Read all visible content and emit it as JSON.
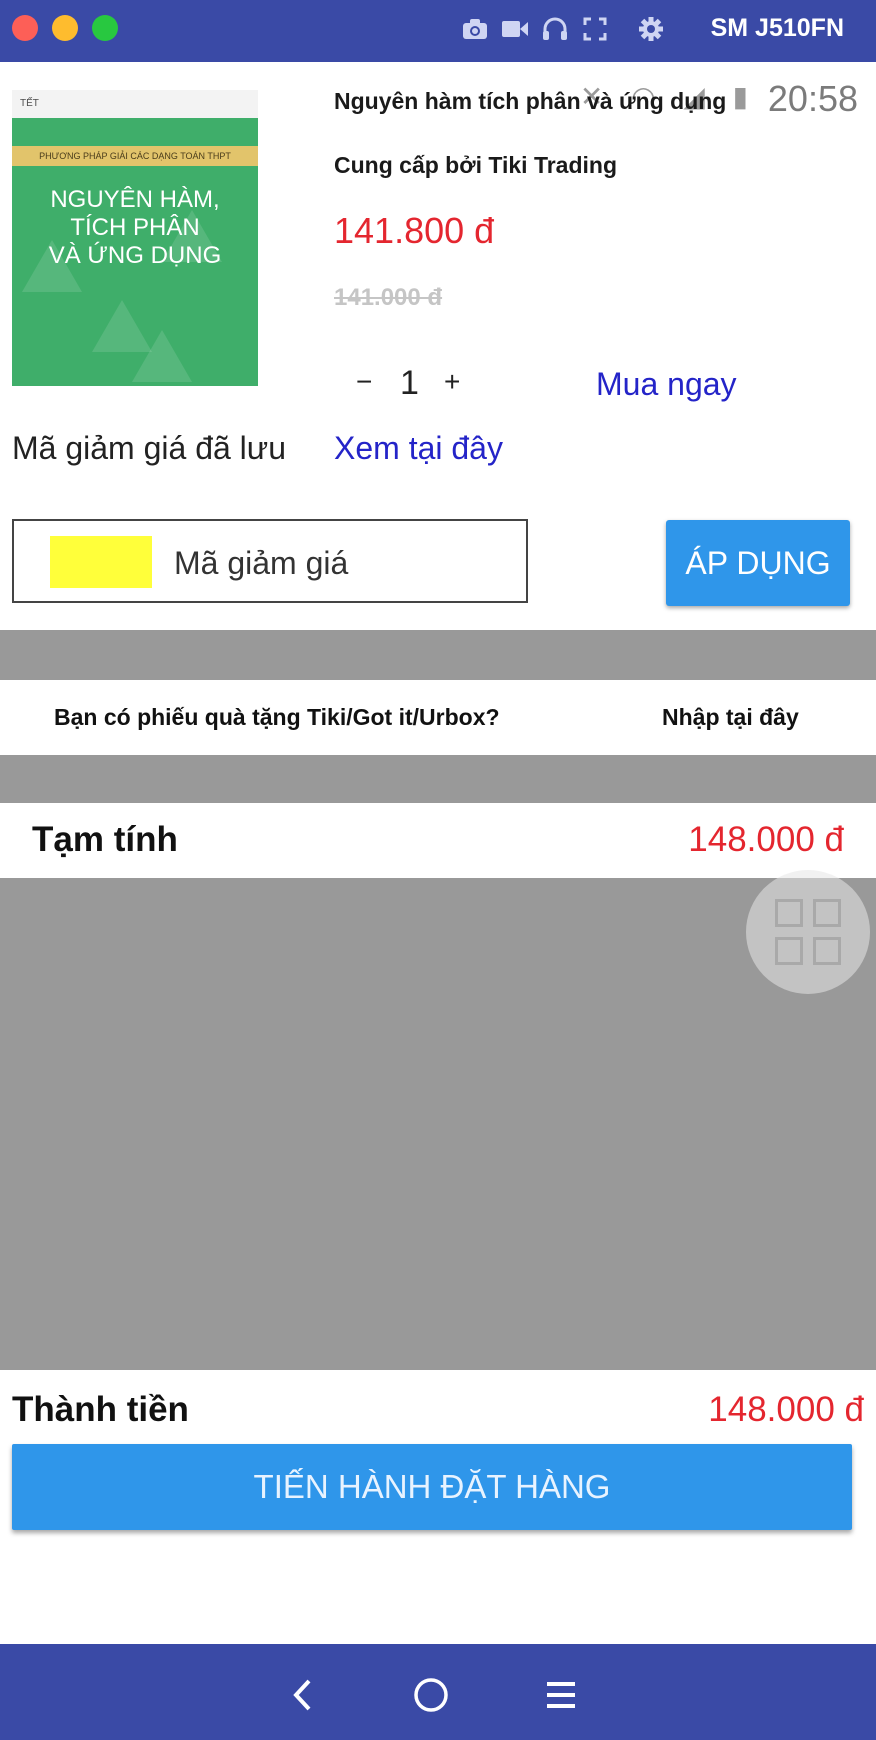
{
  "window": {
    "device_name": "SM J510FN"
  },
  "toolbar_icons": [
    "camera-icon",
    "video-icon",
    "headphones-icon",
    "fullscreen-icon",
    "settings-icon"
  ],
  "status_bar": {
    "time": "20:58"
  },
  "product": {
    "cover_header": "TẾT",
    "cover_band": "PHƯƠNG PHÁP GIẢI CÁC DẠNG TOÁN THPT",
    "cover_line1": "NGUYÊN HÀM,",
    "cover_line2": "TÍCH PHÂN",
    "cover_line3": "VÀ ỨNG DỤNG",
    "title": "Nguyên hàm tích phân và ứng dụng",
    "seller": "Cung cấp bởi Tiki Trading",
    "price": "141.800 đ",
    "old_price": "141.000 đ",
    "quantity": "1",
    "minus": "−",
    "plus": "+",
    "buy_now": "Mua ngay"
  },
  "coupon": {
    "saved_label": "Mã giảm giá đã lưu",
    "saved_link": "Xem tại đây",
    "input_placeholder": "Mã giảm giá",
    "apply_label": "ÁP DỤNG"
  },
  "gift": {
    "question": "Bạn có phiếu quà tặng Tiki/Got it/Urbox?",
    "link": "Nhập tại đây"
  },
  "summary": {
    "subtotal_label": "Tạm tính",
    "subtotal_value": "148.000 đ",
    "total_label": "Thành tiền",
    "total_value": "148.000 đ",
    "checkout_label": "TIẾN HÀNH ĐẶT HÀNG"
  },
  "colors": {
    "window_bar": "#3a4aa6",
    "accent_button": "#2f96ea",
    "price_red": "#e4262f",
    "link_blue": "#2424c8",
    "panel_gray": "#999999"
  }
}
